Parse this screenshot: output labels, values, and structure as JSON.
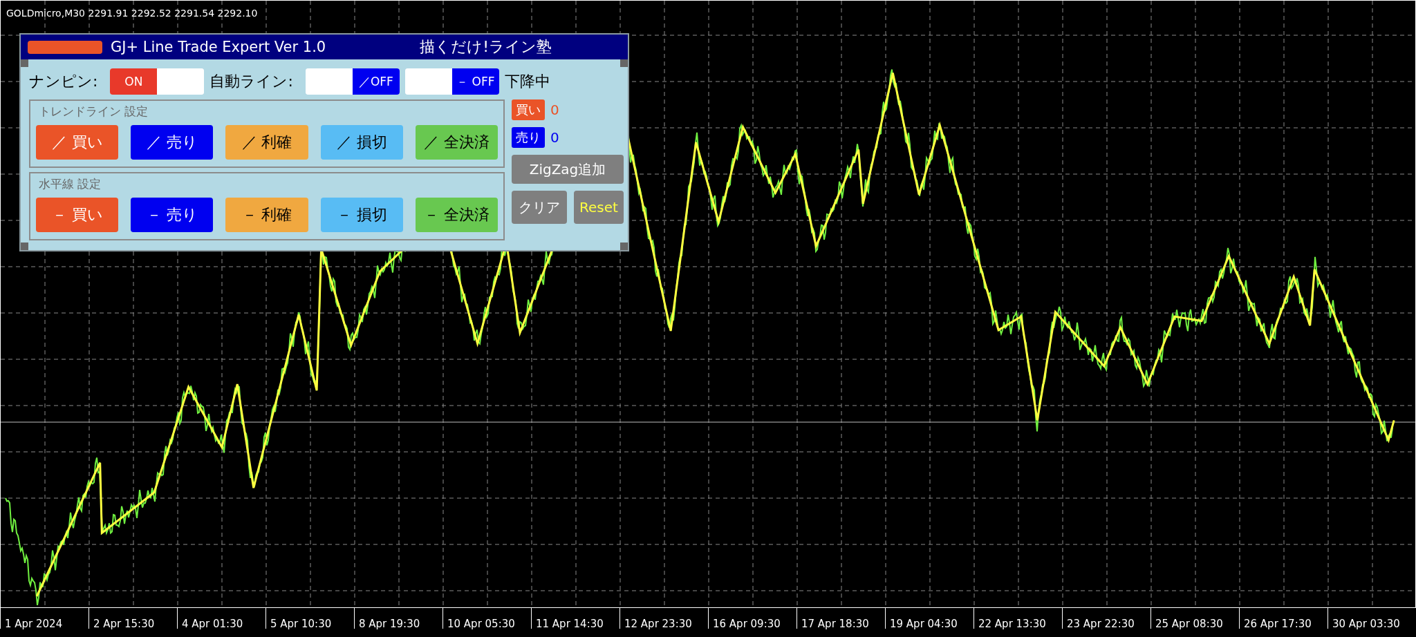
{
  "chart": {
    "symbol": "GOLDmicro,M30",
    "quote": "2291.91 2292.52 2291.54 2292.10"
  },
  "panel": {
    "title": "GJ+ Line Trade Expert Ver 1.0",
    "subtitle": "描くだけ!ライン塾",
    "controls": [
      {
        "kind": "label",
        "text": "ナンピン:"
      },
      {
        "kind": "toggle",
        "text": "ON",
        "on": true
      },
      {
        "kind": "label",
        "text": "自動ライン:"
      },
      {
        "kind": "toggle",
        "text": "／OFF",
        "on": false
      },
      {
        "kind": "toggle",
        "text": "－ OFF",
        "on": false
      },
      {
        "kind": "status",
        "text": "下降中"
      }
    ],
    "groups": [
      {
        "title": "トレンドライン 設定",
        "buttons": [
          {
            "label": "／ 買い",
            "color": "#ea5428"
          },
          {
            "label": "／ 売り",
            "color": "#0000f0"
          },
          {
            "label": "／ 利確",
            "color": "#f0a840"
          },
          {
            "label": "／ 損切",
            "color": "#58bcf4"
          },
          {
            "label": "／ 全決済",
            "color": "#68c850"
          }
        ]
      },
      {
        "title": "水平線 設定",
        "buttons": [
          {
            "label": "－ 買い",
            "color": "#ea5428"
          },
          {
            "label": "－ 売り",
            "color": "#0000f0"
          },
          {
            "label": "－ 利確",
            "color": "#f0a840"
          },
          {
            "label": "－ 損切",
            "color": "#58bcf4"
          },
          {
            "label": "－ 全決済",
            "color": "#68c850"
          }
        ]
      }
    ],
    "counters": [
      {
        "label": "買い",
        "count": "0",
        "color": "#ea5428"
      },
      {
        "label": "売り",
        "count": "0",
        "color": "#0000f0"
      }
    ],
    "actions": [
      {
        "label": "ZigZag追加",
        "kind": "wide"
      },
      {
        "label": "クリア",
        "kind": "plain"
      },
      {
        "label": "Reset",
        "kind": "reset"
      }
    ]
  },
  "axis": {
    "labels": [
      "1 Apr 2024",
      "2 Apr 15:30",
      "4 Apr 01:30",
      "5 Apr 10:30",
      "8 Apr 19:30",
      "10 Apr 05:30",
      "11 Apr 14:30",
      "12 Apr 23:30",
      "16 Apr 09:30",
      "17 Apr 18:30",
      "19 Apr 04:30",
      "22 Apr 13:30",
      "23 Apr 22:30",
      "25 Apr 08:30",
      "26 Apr 17:30",
      "30 Apr 03:30"
    ]
  }
}
